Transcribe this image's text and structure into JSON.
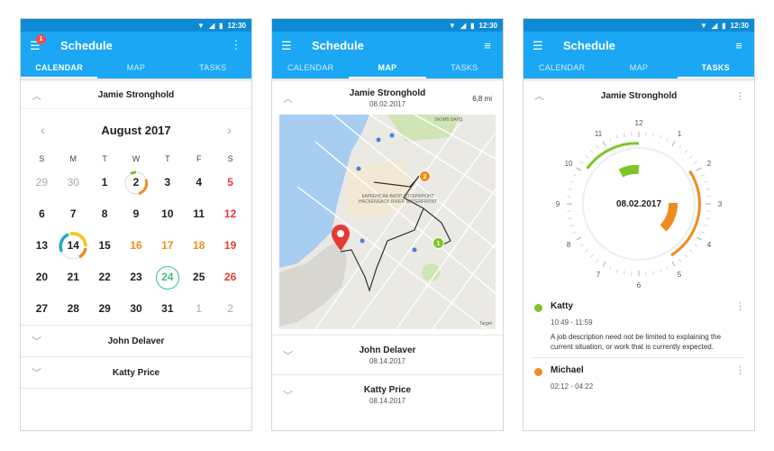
{
  "status": {
    "time": "12:30"
  },
  "app": {
    "title": "Schedule",
    "badge": "1"
  },
  "tabs": [
    "CALENDAR",
    "MAP",
    "TASKS"
  ],
  "calendar_screen": {
    "person": "Jamie Stronghold",
    "month": "August 2017",
    "weekdays": [
      "S",
      "M",
      "T",
      "W",
      "T",
      "F",
      "S"
    ],
    "weeks": [
      [
        "29",
        "30",
        "1",
        "2",
        "3",
        "4",
        "5"
      ],
      [
        "6",
        "7",
        "8",
        "9",
        "10",
        "11",
        "12"
      ],
      [
        "13",
        "14",
        "15",
        "16",
        "17",
        "18",
        "19"
      ],
      [
        "20",
        "21",
        "22",
        "23",
        "24",
        "25",
        "26"
      ],
      [
        "27",
        "28",
        "29",
        "30",
        "31",
        "1",
        "2"
      ]
    ],
    "rows": [
      "John Delaver",
      "Katty Price"
    ],
    "colors": {
      "red": "#e53935",
      "orange": "#f08c1c",
      "green": "#3cc47c",
      "teal": "#1da9c9",
      "yellow": "#f5c518"
    }
  },
  "map_screen": {
    "person": "Jamie Stronghold",
    "date": "08.02.2017",
    "distance": "6,8 mi",
    "map_labels": [
      "КАРКЕНСАК-ВИЛЛ ХОТЕРФРОНТ",
      "HACKENSACK RIVER WATERFRONT",
      "ЗАЛИВ БАРД",
      "Target"
    ],
    "pins": [
      "2",
      "1"
    ],
    "rows": [
      {
        "name": "John Delaver",
        "date": "08.14.2017"
      },
      {
        "name": "Katty Price",
        "date": "08.14.2017"
      }
    ]
  },
  "tasks_screen": {
    "person": "Jamie Stronghold",
    "clock_center": "08.02.2017",
    "clock_numbers": [
      "12",
      "1",
      "2",
      "3",
      "4",
      "5",
      "6",
      "7",
      "8",
      "9",
      "10",
      "11"
    ],
    "tasks": [
      {
        "name": "Katty",
        "time": "10:49 - 11:59",
        "desc": "A job description need not be limited to explaining the current situation, or work that is currently expected.",
        "color": "#7cc62a"
      },
      {
        "name": "Michael",
        "time": "02:12 - 04:22",
        "desc": "",
        "color": "#f08c1c"
      }
    ]
  }
}
